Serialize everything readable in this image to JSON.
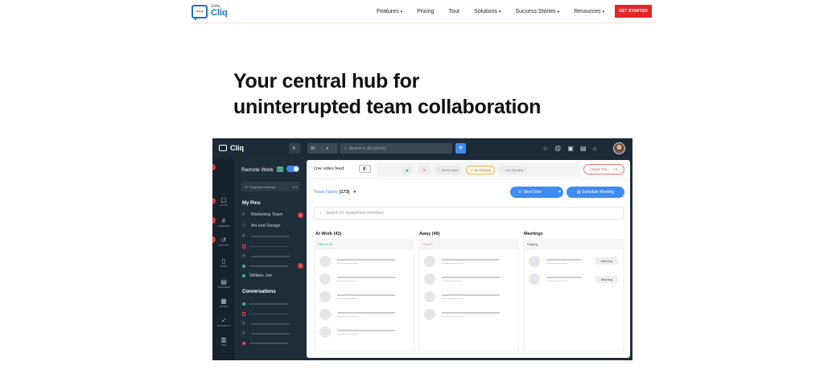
{
  "nav": {
    "logo_zoho": "Zoho",
    "logo_cliq": "Cliq",
    "links": [
      {
        "label": "Features",
        "caret": "▾"
      },
      {
        "label": "Pricing",
        "caret": ""
      },
      {
        "label": "Tour",
        "caret": ""
      },
      {
        "label": "Solutions",
        "caret": "▾"
      },
      {
        "label": "Success Stories",
        "caret": "▾"
      },
      {
        "label": "Resources",
        "caret": "▾"
      }
    ],
    "cta": "GET STARTED"
  },
  "hero": {
    "line1": "Your central hub for",
    "line2": "uninterrupted team collaboration"
  },
  "app": {
    "brand": "Cliq",
    "all_filter": "All",
    "search_placeholder": "Search in All (ctrl+E)",
    "rail": {
      "chats": "CHATS",
      "channels": "CHANNELS",
      "history": "HISTORY",
      "files": "FILES",
      "calendar": "CALENDAR",
      "notes": "NOTES",
      "projects": "PROJECTS",
      "org": "ORG"
    },
    "panel": {
      "workspace": "Remote Work",
      "ongoing": "Ongoing meetings",
      "pins_title": "My Pins",
      "pin_marketing": "Marketing Team",
      "pin_marketing_badge": "3",
      "pin_art": "Art and Design",
      "pin_unread_badge": "7",
      "pin_william": "William Joe",
      "conversations_title": "Conversations"
    },
    "main": {
      "video_feed": "Live video feed:",
      "status_pills": [
        "for 40 mins",
        "for 15 mins",
        "for 15 mins"
      ],
      "checkout": "Check Out",
      "team_label": "Team Name",
      "team_count": "(173)",
      "meet_now": "Meet Now",
      "schedule": "Schedule Meeting",
      "search_members": "Search for department members",
      "columns": {
        "at_work": "At Work (43)",
        "at_work_sub": "Office to 30",
        "away": "Away (49)",
        "away_sub": "Leave 9",
        "meetings": "Meetings",
        "meetings_sub": "Ongoing",
        "meeting_tag": "Meeting"
      }
    }
  },
  "colors": {
    "accent": "#3d8bf3",
    "cta": "#e42527",
    "app_bg": "#1f2d3b"
  }
}
